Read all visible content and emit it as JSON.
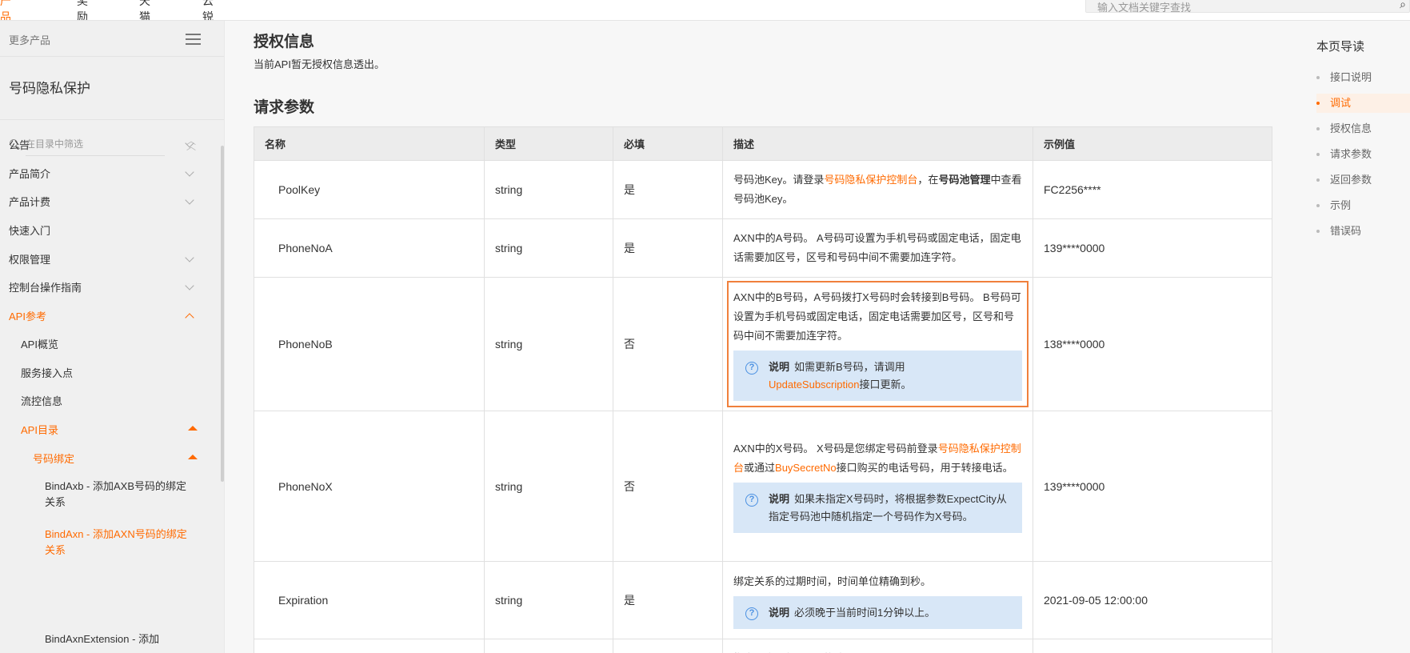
{
  "topnav": {
    "items": [
      "产品文档",
      "奖励源",
      "天猫官",
      "云锐坪"
    ],
    "search_placeholder": "输入文档关键字查找"
  },
  "sidebar": {
    "more_products": "更多产品",
    "product_name": "号码隐私保护",
    "filter_placeholder": "在目录中筛选",
    "items": [
      {
        "label": "公告"
      },
      {
        "label": "产品简介"
      },
      {
        "label": "产品计费"
      },
      {
        "label": "快速入门"
      },
      {
        "label": "权限管理"
      },
      {
        "label": "控制台操作指南"
      },
      {
        "label": "API参考"
      },
      {
        "label": "API概览"
      },
      {
        "label": "服务接入点"
      },
      {
        "label": "流控信息"
      },
      {
        "label": "API目录"
      },
      {
        "label": "号码绑定"
      },
      {
        "label": "BindAxb - 添加AXB号码的绑定关系"
      },
      {
        "label": "BindAxn - 添加AXN号码的绑定关系"
      },
      {
        "label": "BindAxnExtension - 添加"
      }
    ]
  },
  "main": {
    "auth_title": "授权信息",
    "auth_desc": "当前API暂无授权信息透出。",
    "req_title": "请求参数",
    "columns": [
      "名称",
      "类型",
      "必填",
      "描述",
      "示例值"
    ],
    "rows": [
      {
        "name": "PoolKey",
        "type": "string",
        "required": "是",
        "desc_1": "号码池Key。请登录",
        "desc_link": "号码隐私保护控制台",
        "desc_2": "，在",
        "desc_bold": "号码池管理",
        "desc_3": "中查看号码池Key。",
        "example": "FC2256****"
      },
      {
        "name": "PhoneNoA",
        "type": "string",
        "required": "是",
        "desc": "AXN中的A号码。 A号码可设置为手机号码或固定电话，固定电话需要加区号，区号和号码中间不需要加连字符。",
        "example": "139****0000"
      },
      {
        "name": "PhoneNoB",
        "type": "string",
        "required": "否",
        "desc": "AXN中的B号码，A号码拨打X号码时会转接到B号码。 B号码可设置为手机号码或固定电话，固定电话需要加区号，区号和号码中间不需要加连字符。",
        "note_title": "说明",
        "note_1": "如需更新B号码，请调用",
        "note_link": "UpdateSubscription",
        "note_2": "接口更新。",
        "example": "138****0000"
      },
      {
        "name": "PhoneNoX",
        "type": "string",
        "required": "否",
        "desc_1": "AXN中的X号码。 X号码是您绑定号码前登录",
        "desc_link1": "号码隐私保护控制台",
        "desc_2": "或通过",
        "desc_link2": "BuySecretNo",
        "desc_3": "接口购买的电话号码，用于转接电话。",
        "note_title": "说明",
        "note": "如果未指定X号码时，将根据参数ExpectCity从指定号码池中随机指定一个号码作为X号码。",
        "example": "139****0000"
      },
      {
        "name": "Expiration",
        "type": "string",
        "required": "是",
        "desc": "绑定关系的过期时间，时间单位精确到秒。",
        "note_title": "说明",
        "note": "必须晚于当前时间1分钟以上。",
        "example": "2021-09-05 12:00:00"
      },
      {
        "desc": "指定城市进行X号码的选号"
      }
    ]
  },
  "toc": {
    "title": "本页导读",
    "items": [
      "接口说明",
      "调试",
      "授权信息",
      "请求参数",
      "返回参数",
      "示例",
      "错误码"
    ]
  },
  "colors": {
    "accent": "#ff6a00",
    "highlight_border": "#f0803c",
    "note_bg": "#d8e7f7"
  }
}
